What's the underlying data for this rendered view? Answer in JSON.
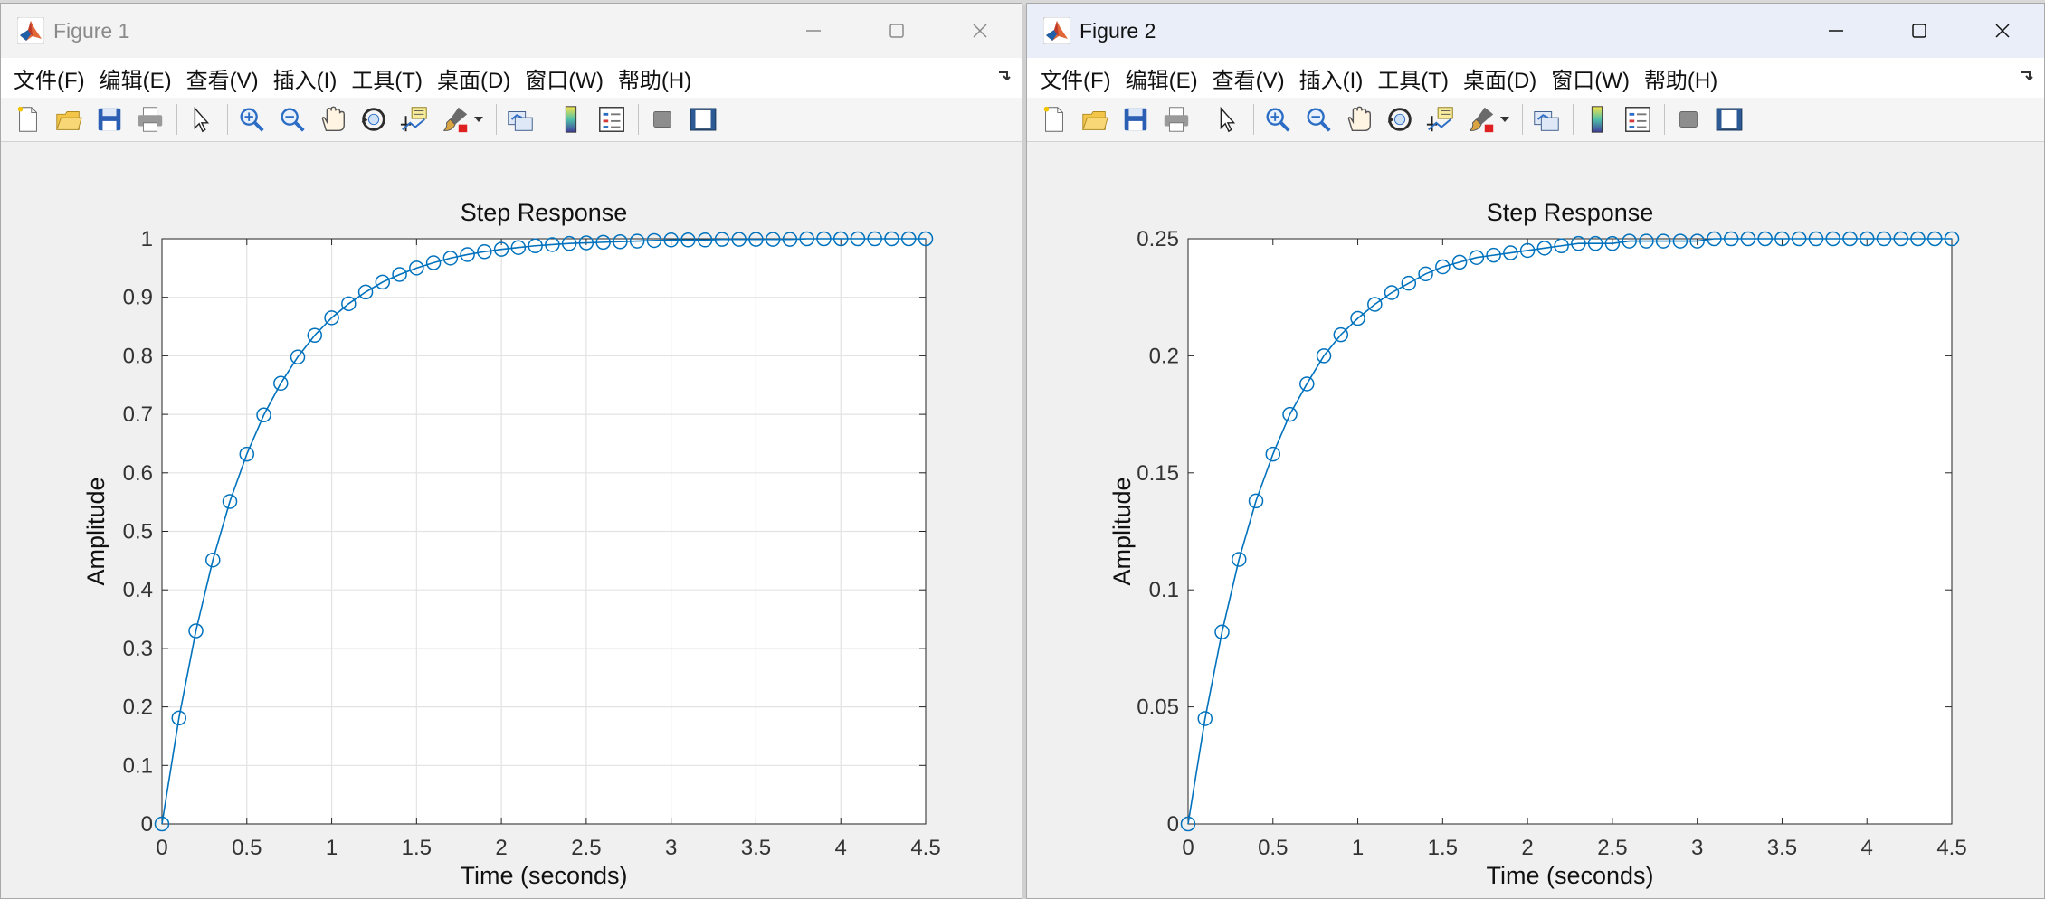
{
  "windows": [
    {
      "title": "Figure 1",
      "menu": [
        "文件(F)",
        "编辑(E)",
        "查看(V)",
        "插入(I)",
        "工具(T)",
        "桌面(D)",
        "窗口(W)",
        "帮助(H)"
      ],
      "toolbar_icons": [
        "new-figure-icon",
        "open-file-icon",
        "save-icon",
        "print-icon",
        "pointer-icon",
        "zoom-in-icon",
        "zoom-out-icon",
        "pan-icon",
        "rotate-3d-icon",
        "data-cursor-icon",
        "brush-icon",
        "link-plot-icon",
        "colorbar-icon",
        "legend-icon",
        "hide-plot-tools-icon",
        "show-plot-tools-icon"
      ],
      "chart_data": {
        "type": "line",
        "title": "Step Response",
        "xlabel": "Time (seconds)",
        "ylabel": "Amplitude",
        "xlim": [
          0,
          4.5
        ],
        "ylim": [
          0,
          1
        ],
        "xticks": [
          "0",
          "0.5",
          "1",
          "1.5",
          "2",
          "2.5",
          "3",
          "3.5",
          "4",
          "4.5"
        ],
        "yticks": [
          "0",
          "0.1",
          "0.2",
          "0.3",
          "0.4",
          "0.5",
          "0.6",
          "0.7",
          "0.8",
          "0.9",
          "1"
        ],
        "grid": true,
        "marker": "circle",
        "series_color": "#0072bd",
        "steady_state": 1,
        "x": [
          0,
          0.1,
          0.2,
          0.3,
          0.4,
          0.5,
          0.6,
          0.7,
          0.8,
          0.9,
          1.0,
          1.1,
          1.2,
          1.3,
          1.4,
          1.5,
          1.6,
          1.7,
          1.8,
          1.9,
          2.0,
          2.1,
          2.2,
          2.3,
          2.4,
          2.5,
          2.6,
          2.7,
          2.8,
          2.9,
          3.0,
          3.1,
          3.2,
          3.3,
          3.4,
          3.5,
          3.6,
          3.7,
          3.8,
          3.9,
          4.0,
          4.1,
          4.2,
          4.3,
          4.4,
          4.5
        ],
        "y": [
          0,
          0.181,
          0.33,
          0.451,
          0.551,
          0.632,
          0.699,
          0.753,
          0.798,
          0.835,
          0.865,
          0.889,
          0.909,
          0.926,
          0.939,
          0.95,
          0.959,
          0.967,
          0.973,
          0.978,
          0.982,
          0.985,
          0.988,
          0.99,
          0.992,
          0.993,
          0.994,
          0.995,
          0.996,
          0.997,
          0.998,
          0.998,
          0.998,
          0.999,
          0.999,
          0.999,
          0.999,
          0.999,
          1.0,
          1.0,
          1.0,
          1.0,
          1.0,
          1.0,
          1.0,
          1.0
        ]
      }
    },
    {
      "title": "Figure 2",
      "menu": [
        "文件(F)",
        "编辑(E)",
        "查看(V)",
        "插入(I)",
        "工具(T)",
        "桌面(D)",
        "窗口(W)",
        "帮助(H)"
      ],
      "toolbar_icons": [
        "new-figure-icon",
        "open-file-icon",
        "save-icon",
        "print-icon",
        "pointer-icon",
        "zoom-in-icon",
        "zoom-out-icon",
        "pan-icon",
        "rotate-3d-icon",
        "data-cursor-icon",
        "brush-icon",
        "link-plot-icon",
        "colorbar-icon",
        "legend-icon",
        "hide-plot-tools-icon",
        "show-plot-tools-icon"
      ],
      "chart_data": {
        "type": "line",
        "title": "Step Response",
        "xlabel": "Time (seconds)",
        "ylabel": "Amplitude",
        "xlim": [
          0,
          4.5
        ],
        "ylim": [
          0,
          0.25
        ],
        "xticks": [
          "0",
          "0.5",
          "1",
          "1.5",
          "2",
          "2.5",
          "3",
          "3.5",
          "4",
          "4.5"
        ],
        "yticks": [
          "0",
          "0.05",
          "0.1",
          "0.15",
          "0.2",
          "0.25"
        ],
        "grid": false,
        "marker": "circle",
        "series_color": "#0072bd",
        "steady_state": 0.25,
        "x": [
          0,
          0.1,
          0.2,
          0.3,
          0.4,
          0.5,
          0.6,
          0.7,
          0.8,
          0.9,
          1.0,
          1.1,
          1.2,
          1.3,
          1.4,
          1.5,
          1.6,
          1.7,
          1.8,
          1.9,
          2.0,
          2.1,
          2.2,
          2.3,
          2.4,
          2.5,
          2.6,
          2.7,
          2.8,
          2.9,
          3.0,
          3.1,
          3.2,
          3.3,
          3.4,
          3.5,
          3.6,
          3.7,
          3.8,
          3.9,
          4.0,
          4.1,
          4.2,
          4.3,
          4.4,
          4.5
        ],
        "y": [
          0,
          0.045,
          0.082,
          0.113,
          0.138,
          0.158,
          0.175,
          0.188,
          0.2,
          0.209,
          0.216,
          0.222,
          0.227,
          0.231,
          0.235,
          0.238,
          0.24,
          0.242,
          0.243,
          0.244,
          0.245,
          0.246,
          0.247,
          0.248,
          0.248,
          0.248,
          0.249,
          0.249,
          0.249,
          0.249,
          0.249,
          0.25,
          0.25,
          0.25,
          0.25,
          0.25,
          0.25,
          0.25,
          0.25,
          0.25,
          0.25,
          0.25,
          0.25,
          0.25,
          0.25,
          0.25
        ]
      }
    }
  ]
}
